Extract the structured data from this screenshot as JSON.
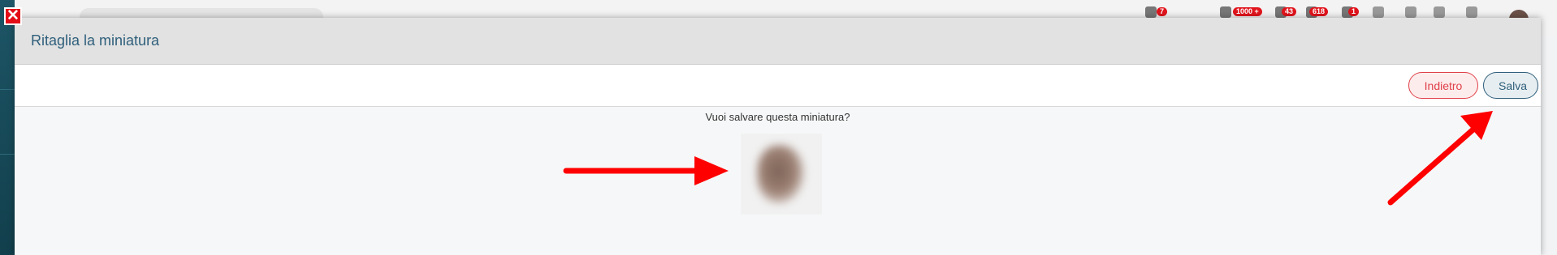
{
  "modal": {
    "title": "Ritaglia la miniatura",
    "back_label": "Indietro",
    "save_label": "Salva",
    "question": "Vuoi salvare questa miniatura?"
  },
  "close_button": {
    "icon": "close-icon",
    "glyph": "✕"
  },
  "topbar": {
    "badges": [
      "7",
      "1000 +",
      "43",
      "618",
      "1"
    ]
  },
  "colors": {
    "accent": "#2f5f7b",
    "danger": "#e0414a",
    "annotation": "#ff0000",
    "close": "#e30d17"
  }
}
